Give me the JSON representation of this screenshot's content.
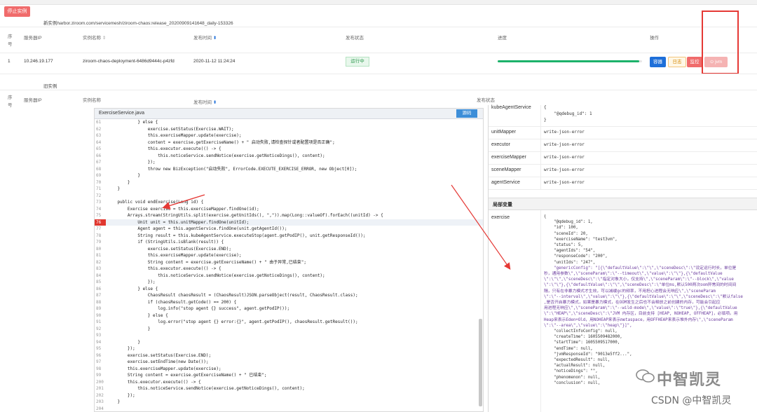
{
  "page": {
    "stop_button": "停止实例",
    "new_instance_label": "新实例harbor.ziroom.com/servicemesh/ziroom-chaos:release_20200909141648_daily-153326",
    "old_instance_label": "旧实例",
    "headers": {
      "seq": "序号",
      "server_ip": "服务器IP",
      "instance_name": "实例名称",
      "publish_time": "发布时间",
      "publish_status": "发布状态",
      "progress": "进度",
      "operation": "操作"
    },
    "row": {
      "seq": "1",
      "server_ip": "10.246.19.177",
      "instance_name": "ziroom-chaos-deployment-6486d9444c-p4zfd",
      "publish_time": "2020-11-12 11:24:24",
      "status": "运行中",
      "progress": 0.98,
      "btn_deploy": "容器",
      "btn_log": "日志",
      "btn_monitor": "监控",
      "btn_jvm": "⊙ jvm"
    },
    "colors": {
      "accent_blue": "#1e6fd9",
      "danger": "#f06b6b",
      "success": "#1cb26a",
      "annotation_red": "#e53935"
    }
  },
  "ide": {
    "tab_title": "ExerciseService.java",
    "tab_button": "源码",
    "lines": [
      {
        "n": "61",
        "t": "            } else {"
      },
      {
        "n": "62",
        "t": "                exercise.setStatus(Exercise.WAIT);"
      },
      {
        "n": "63",
        "t": "                this.exerciseMapper.update(exercise);"
      },
      {
        "n": "64",
        "t": "                content = exercise.getExerciseName() + \" 启动失败,请检查探针或者配置项是否正确\";"
      },
      {
        "n": "65",
        "t": "                this.executor.execute(() -> {"
      },
      {
        "n": "66",
        "t": "                    this.noticeService.sendNotice(exercise.getNoticeDings(), content);"
      },
      {
        "n": "67",
        "t": "                });"
      },
      {
        "n": "68",
        "t": "                throw new BizException(\"启动失败\", ErrorCode.EXECUTE_EXERCISE_ERROR, new Object[0]);"
      },
      {
        "n": "69",
        "t": "            }"
      },
      {
        "n": "70",
        "t": "        }"
      },
      {
        "n": "71",
        "t": "    }"
      },
      {
        "n": "72",
        "t": ""
      },
      {
        "n": "73",
        "t": "    public void endExercise(Long id) {"
      },
      {
        "n": "74",
        "t": "        Exercise exercise = this.exerciseMapper.findOne(id);"
      },
      {
        "n": "75",
        "t": "        Arrays.stream(StringUtils.split(exercise.getUnitIds(), \",\")).map(Long::valueOf).forEach((unitId) -> {"
      },
      {
        "n": "76",
        "t": "            Unit unit = this.unitMapper.findOne(unitId);"
      },
      {
        "n": "77",
        "t": "            Agent agent = this.agentService.findOne(unit.getAgentId());"
      },
      {
        "n": "78",
        "t": "            String result = this.kubeAgentService.executeStop(agent.getPodIP(), unit.getResponseId());"
      },
      {
        "n": "79",
        "t": "            if (StringUtils.isBlank(result)) {"
      },
      {
        "n": "80",
        "t": "                exercise.setStatus(Exercise.END);"
      },
      {
        "n": "81",
        "t": "                this.exerciseMapper.update(exercise);"
      },
      {
        "n": "82",
        "t": "                String content = exercise.getExerciseName() + \" 由于异常,已结束\";"
      },
      {
        "n": "83",
        "t": "                this.executor.execute(() -> {"
      },
      {
        "n": "84",
        "t": "                    this.noticeService.sendNotice(exercise.getNoticeDings(), content);"
      },
      {
        "n": "85",
        "t": "                });"
      },
      {
        "n": "86",
        "t": "            } else {"
      },
      {
        "n": "87",
        "t": "                ChaosResult chaosResult = (ChaosResult)JSON.parseObject(result, ChaosResult.class);"
      },
      {
        "n": "88",
        "t": "                if (chaosResult.getCode() == 200) {"
      },
      {
        "n": "89",
        "t": "                    log.info(\"stop agent {} success\", agent.getPodIP());"
      },
      {
        "n": "90",
        "t": "                } else {"
      },
      {
        "n": "91",
        "t": "                    log.error(\"stop agent {} error:{}\", agent.getPodIP(), chaosResult.getResult());"
      },
      {
        "n": "92",
        "t": "                }"
      },
      {
        "n": "93",
        "t": ""
      },
      {
        "n": "94",
        "t": "            }"
      },
      {
        "n": "95",
        "t": "        });"
      },
      {
        "n": "96",
        "t": "        exercise.setStatus(Exercise.END);"
      },
      {
        "n": "97",
        "t": "        exercise.setEndTime(new Date());"
      },
      {
        "n": "98",
        "t": "        this.exerciseMapper.update(exercise);"
      },
      {
        "n": "99",
        "t": "        String content = exercise.getExerciseName() + \" 已结束\";"
      },
      {
        "n": "200",
        "t": "        this.executor.execute(() -> {"
      },
      {
        "n": "201",
        "t": "            this.noticeService.sendNotice(exercise.getNoticeDings(), content);"
      },
      {
        "n": "202",
        "t": "        });"
      },
      {
        "n": "203",
        "t": "    }"
      },
      {
        "n": "204",
        "t": ""
      }
    ],
    "breakpoint_line": "76"
  },
  "debug": {
    "vars": [
      {
        "key": "kubeAgentService",
        "lines": [
          "{",
          "    \"@qdebug_id\": 1",
          "}"
        ]
      },
      {
        "key": "unitMapper",
        "lines": [
          "write-json-error"
        ]
      },
      {
        "key": "executor",
        "lines": [
          "write-json-error"
        ]
      },
      {
        "key": "exerciseMapper",
        "lines": [
          "write-json-error"
        ]
      },
      {
        "key": "sceneMapper",
        "lines": [
          "write-json-error"
        ]
      },
      {
        "key": "agentService",
        "lines": [
          "write-json-error"
        ]
      }
    ],
    "local_title": "局部变量",
    "local_var_key": "exercise",
    "json_lines": [
      "{",
      "    \"@qdebug_id\": 1,",
      "    \"id\": 100,",
      "    \"sceneId\": 20,",
      "    \"exerciseName\": \"test3vm\",",
      "    \"status\": 5,",
      "    \"agentIds\": \"54\",",
      "    \"responseCode\": \"200\",",
      "    \"unitIds\": \"247\",",
      "    \"genericConfig\": \"[{\\\"defaultValue\\\":\\\"\\\",\\\"sceneDesc\\\":\\\"设定运行时长，单位是",
      "秒，通用参数\\\",\\\"sceneParam\\\":\\\"--timeout\\\",\\\"value\\\":\\\"\\\"},{\\\"defaultValue",
      "\\\":\\\"\\\",\\\"sceneDesc\\\":\\\"指定对象大小，仅支持\\\",\\\"sceneParam\\\":\\\"--block\\\",\\\"value",
      "\\\":\\\"\\\"},{\\\"defaultValue\\\":\\\"\\\",\\\"sceneDesc\\\":\\\"单位ms,默认500两次oom异常间的时间间",
      "隔，只有在非暴力模式才生效，可以减缓gc的频率，不用担心进程会无响应\\\",\\\"sceneParam",
      "\\\":\\\"--interval\\\",\\\"value\\\":\\\"\\\"},{\\\"defaultValue\\\":\\\"\\\",\\\"sceneDesc\\\":\\\"默认false",
      ",是否开启暴力模式，如果是暴力模式，在OOM发生之后也不会释放之前创建的内存，可能会引起应",
      "用进程无响应\\\",\\\"sceneParam\\\":\\\"--wild-mode\\\",\\\"value\\\":\\\"true\\\"},{\\\"defaultValue",
      "\\\":\\\"HEAP\\\",\\\"sceneDesc\\\":\\\"JVM 内存区，目前支持 [HEAP, NOHEAP, OFFHEAP]，必填项。用",
      "Heap来表示Eden+Old，用NOHEAP来表示metaspace，用OFFHEAP来表示堆外内存\\\",\\\"sceneParam",
      "\\\":\\\"--area\\\",\\\"value\\\":\\\"heap\\\"}]\",",
      "    \"collectInfoConfig\": null,",
      "    \"createTime\": 1605509482000,",
      "    \"startTime\": 1605509517000,",
      "    \"endTime\": null,",
      "    \"jvmResponseId\": \"9013e5ff2...\",",
      "    \"expectedResult\": null,",
      "    \"actualResult\": null,",
      "    \"noticeDings\": \"\",",
      "    \"phenomenon\": null,",
      "    \"conclusion\": null,"
    ]
  },
  "watermark": {
    "logo_text": "中智凯灵",
    "csdn_text": "CSDN @中智凯灵"
  }
}
